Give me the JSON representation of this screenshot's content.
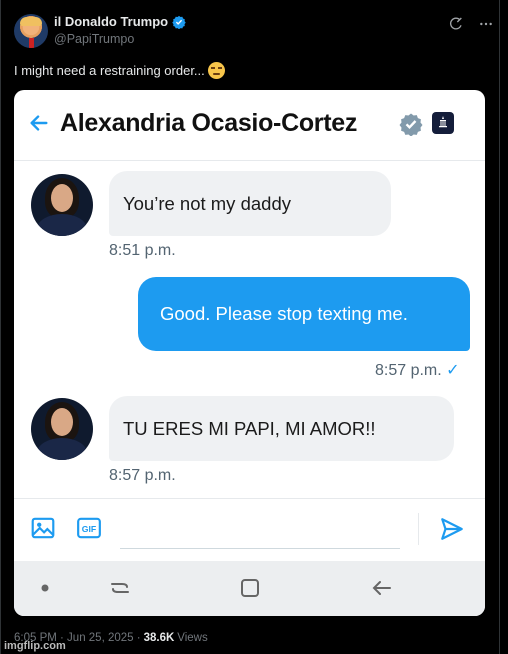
{
  "tweet": {
    "display_name": "il Donaldo Trumpo",
    "handle": "@PapiTrumpo",
    "text": "I might need a restraining order...",
    "emoji_icon": "unamused-face-icon",
    "timestamp": "6:05 PM · Jun 25, 2025 ·",
    "views_count": "38.6K",
    "views_label": "Views"
  },
  "dm": {
    "contact_name": "Alexandria Ocasio-Cortez",
    "messages": [
      {
        "direction": "in",
        "text": "You’re not my daddy",
        "time": "8:51 p.m."
      },
      {
        "direction": "out",
        "text": "Good. Please stop texting me.",
        "time": "8:57 p.m.",
        "status": "✓"
      },
      {
        "direction": "in",
        "text": "TU ERES MI PAPI, MI AMOR!!",
        "time": "8:57 p.m."
      }
    ],
    "composer_placeholder": ""
  },
  "watermark": "imgflip.com",
  "colors": {
    "accent": "#1d9bf0",
    "background": "#000000",
    "bubble_in": "#eff1f3"
  }
}
